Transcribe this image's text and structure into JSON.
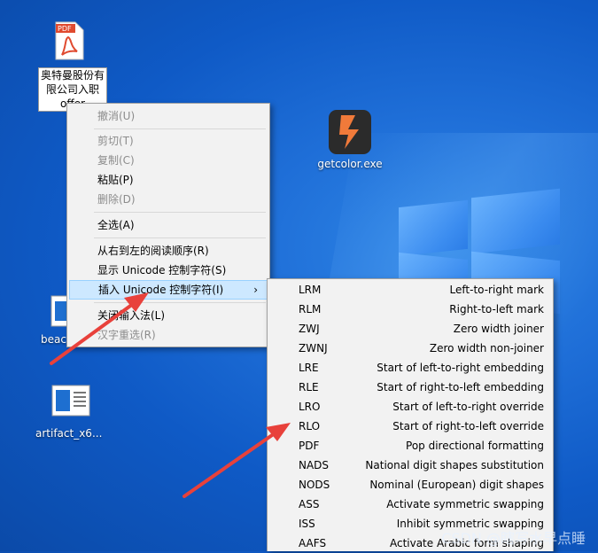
{
  "desktop": {
    "icons": [
      {
        "label": "奥特曼股份有限公司入职offer.pdf",
        "label_visible": "奥特曼股份有限公司入职offer",
        "icon": "pdf-file-icon"
      },
      {
        "label": "getcolor.exe",
        "icon": "getcolor-app-icon"
      },
      {
        "label": "beac",
        "icon": "document-file-icon"
      },
      {
        "label": "artifact_x6...",
        "icon": "document-file-icon"
      }
    ]
  },
  "context_menu": {
    "items": [
      {
        "label": "撤消(U)",
        "disabled": true
      },
      {
        "label": "剪切(T)",
        "disabled": true
      },
      {
        "label": "复制(C)",
        "disabled": true
      },
      {
        "label": "粘贴(P)",
        "disabled": false
      },
      {
        "label": "删除(D)",
        "disabled": true
      },
      {
        "label": "全选(A)",
        "disabled": false
      },
      {
        "label": "从右到左的阅读顺序(R)",
        "disabled": false
      },
      {
        "label": "显示 Unicode 控制字符(S)",
        "disabled": false
      },
      {
        "label": "插入 Unicode 控制字符(I)",
        "disabled": false,
        "submenu_arrow": "›"
      },
      {
        "label": "关闭输入法(L)",
        "disabled": false
      },
      {
        "label": "汉字重选(R)",
        "disabled": true
      }
    ]
  },
  "submenu": {
    "items": [
      {
        "code": "LRM",
        "desc": "Left-to-right mark"
      },
      {
        "code": "RLM",
        "desc": "Right-to-left mark"
      },
      {
        "code": "ZWJ",
        "desc": "Zero width joiner"
      },
      {
        "code": "ZWNJ",
        "desc": "Zero width non-joiner"
      },
      {
        "code": "LRE",
        "desc": "Start of left-to-right embedding"
      },
      {
        "code": "RLE",
        "desc": "Start of right-to-left embedding"
      },
      {
        "code": "LRO",
        "desc": "Start of left-to-right override"
      },
      {
        "code": "RLO",
        "desc": "Start of right-to-left override"
      },
      {
        "code": "PDF",
        "desc": "Pop directional formatting"
      },
      {
        "code": "NADS",
        "desc": "National digit shapes substitution"
      },
      {
        "code": "NODS",
        "desc": "Nominal (European) digit shapes"
      },
      {
        "code": "ASS",
        "desc": "Activate symmetric swapping"
      },
      {
        "code": "ISS",
        "desc": "Inhibit symmetric swapping"
      },
      {
        "code": "AAFS",
        "desc": "Activate Arabic form shaping"
      }
    ]
  },
  "watermark": "CSDN @瞎写水早点睡",
  "colors": {
    "arrow": "#e8413b",
    "menu_bg": "#f2f2f2",
    "hover_bg": "#cde8ff",
    "desktop": "#1f6fd8"
  }
}
